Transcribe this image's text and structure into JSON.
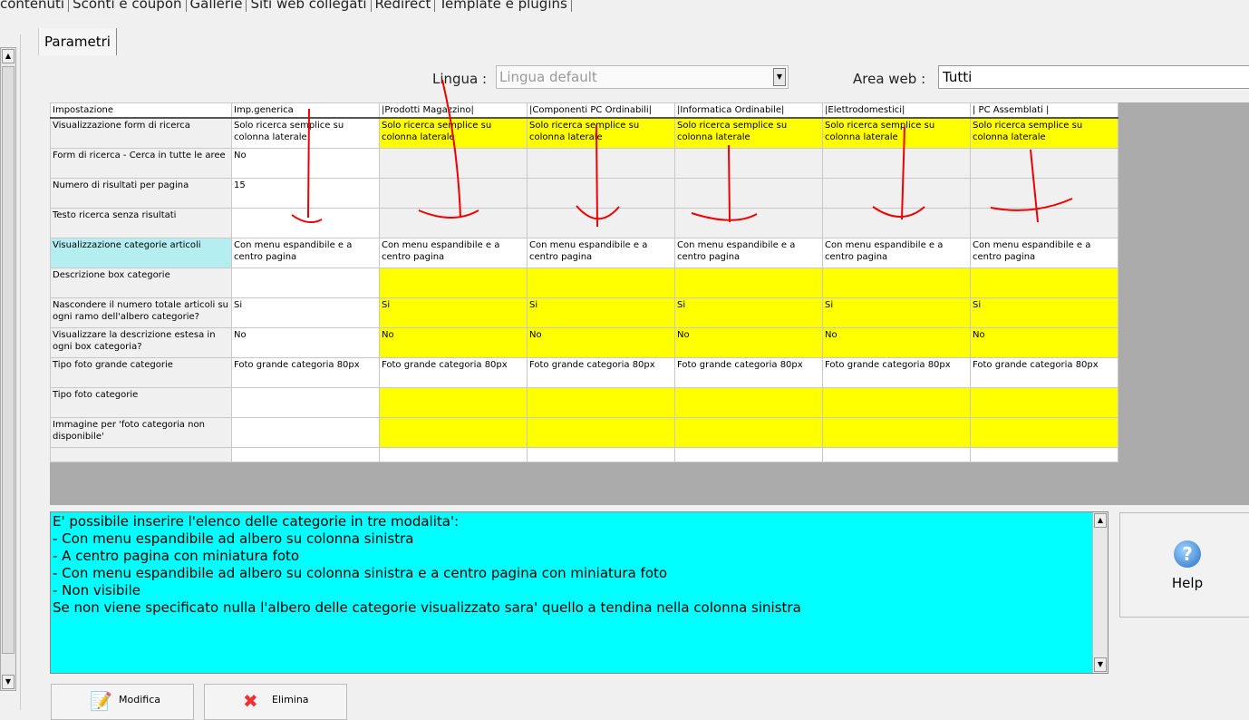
{
  "top_tabs": [
    "contenuti",
    "Sconti e coupon",
    "Gallerie",
    "Siti web collegati",
    "Redirect",
    "Template e plugins"
  ],
  "panel_tab": "Parametri",
  "lingua": {
    "label": "Lingua :",
    "value": "Lingua default"
  },
  "area_web": {
    "label": "Area web :",
    "value": "Tutti"
  },
  "table": {
    "headers": [
      "Impostazione",
      "Imp.generica",
      "|Prodotti Magazzino|",
      "|Componenti PC Ordinabili|",
      "|Informatica Ordinabile|",
      "|Elettrodomestici|",
      "| PC Assemblati |"
    ],
    "rows": [
      {
        "label": "Visualizzazione form di ricerca",
        "generic": "Solo ricerca semplice su colonna laterale",
        "value": "Solo ricerca semplice su colonna laterale",
        "style": "y"
      },
      {
        "label": "Form di ricerca - Cerca in tutte le aree",
        "generic": "No",
        "value": "",
        "style": "g"
      },
      {
        "label": "Numero di risultati per pagina",
        "generic": "15",
        "value": "",
        "style": "g"
      },
      {
        "label": "Testo ricerca senza risultati",
        "generic": "",
        "value": "",
        "style": "g"
      },
      {
        "label": "Visualizzazione categorie articoli",
        "generic": "Con menu espandibile e a centro pagina",
        "value": "Con menu espandibile e a centro pagina",
        "style": "w",
        "selected": true
      },
      {
        "label": "Descrizione box categorie",
        "generic": "",
        "value": "",
        "style": "y"
      },
      {
        "label": "Nascondere il numero totale articoli su ogni ramo dell'albero categorie?",
        "generic": "Si",
        "value": "Si",
        "style": "y"
      },
      {
        "label": "Visualizzare la descrizione estesa in ogni box categoria?",
        "generic": "No",
        "value": "No",
        "style": "y"
      },
      {
        "label": "Tipo foto grande categorie",
        "generic": "Foto grande categoria 80px",
        "value": "Foto grande categoria 80px",
        "style": "w"
      },
      {
        "label": "Tipo foto categorie",
        "generic": "",
        "value": "",
        "style": "y"
      },
      {
        "label": "Immagine per 'foto categoria non disponibile'",
        "generic": "",
        "value": "",
        "style": "y"
      }
    ]
  },
  "description": [
    "E' possibile inserire l'elenco delle categorie in tre modalita':",
    "- Con menu espandibile ad albero su colonna sinistra",
    "- A centro pagina con miniatura foto",
    "- Con menu espandibile ad albero su colonna sinistra e a centro pagina con miniatura foto",
    "- Non visibile",
    "Se non viene specificato nulla l'albero delle categorie visualizzato sara' quello a tendina nella colonna sinistra"
  ],
  "buttons": {
    "help": "Help",
    "modifica": "Modifica",
    "elimina": "Elimina"
  }
}
